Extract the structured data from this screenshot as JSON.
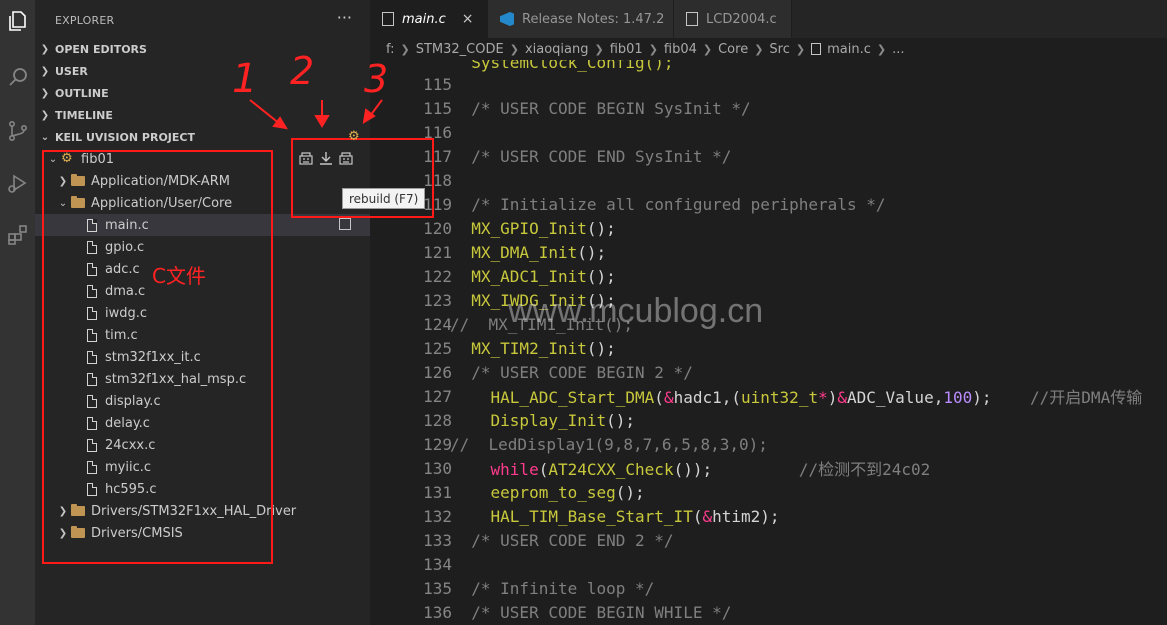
{
  "activity_bar": {
    "items": [
      {
        "name": "explorer-icon"
      },
      {
        "name": "search-icon"
      },
      {
        "name": "source-control-icon"
      },
      {
        "name": "run-debug-icon"
      },
      {
        "name": "extensions-icon"
      }
    ]
  },
  "sidebar": {
    "title": "EXPLORER",
    "more": "···",
    "sections": {
      "open_editors": "OPEN EDITORS",
      "user": "USER",
      "outline": "OUTLINE",
      "timeline": "TIMELINE",
      "keil": "KEIL UVISION PROJECT"
    },
    "project": "fib01",
    "folders": {
      "mdk": "Application/MDK-ARM",
      "core": "Application/User/Core",
      "hal": "Drivers/STM32F1xx_HAL_Driver",
      "cmsis": "Drivers/CMSIS"
    },
    "files": [
      "main.c",
      "gpio.c",
      "adc.c",
      "dma.c",
      "iwdg.c",
      "tim.c",
      "stm32f1xx_it.c",
      "stm32f1xx_hal_msp.c",
      "display.c",
      "delay.c",
      "24cxx.c",
      "myiic.c",
      "hc595.c"
    ],
    "toolbar_icons": [
      "build-icon",
      "download-icon",
      "rebuild-icon"
    ]
  },
  "tabs": [
    {
      "label": "main.c",
      "active": true
    },
    {
      "label": "Release Notes: 1.47.2",
      "active": false
    },
    {
      "label": "LCD2004.c",
      "active": false
    }
  ],
  "breadcrumb": [
    "f:",
    "STM32_CODE",
    "xiaoqiang",
    "fib01",
    "fib04",
    "Core",
    "Src",
    "main.c",
    "..."
  ],
  "tooltip": "rebuild (F7)",
  "editor": {
    "line_numbers": [
      "115",
      "116",
      "117",
      "118",
      "119",
      "120",
      "121",
      "122",
      "123",
      "124",
      "125",
      "126",
      "127",
      "128",
      "129",
      "130",
      "131",
      "132",
      "133",
      "134",
      "135",
      "136"
    ],
    "partial_top_line": "  SystemClock_Config();",
    "lines": {
      "l115": "  /* USER CODE BEGIN SysInit */",
      "l117": "  /* USER CODE END SysInit */",
      "l119": "  /* Initialize all configured peripherals */",
      "l120": "MX_GPIO_Init",
      "l121": "MX_DMA_Init",
      "l122": "MX_ADC1_Init",
      "l123": "MX_IWDG_Init",
      "l124": "//  MX_TIM1_Init();",
      "l125": "MX_TIM2_Init",
      "l126": "  /* USER CODE BEGIN 2 */",
      "l127_fn": "HAL_ADC_Start_DMA",
      "l127_a": "hadc1,(",
      "l127_ty": "uint32_t",
      "l127_b": "ADC_Value,",
      "l127_num": "100",
      "l127_end": ");",
      "l127_cm": "//开启DMA传输",
      "l128": "Display_Init",
      "l129": "//  LedDisplay1(9,8,7,6,5,8,3,0);",
      "l130_kw": "while",
      "l130_fn": "AT24CXX_Check",
      "l130_cm": "//检测不到24c02",
      "l131": "eeprom_to_seg",
      "l132": "HAL_TIM_Base_Start_IT",
      "l132_arg": "htim2",
      "l133": "  /* USER CODE END 2 */",
      "l135": "  /* Infinite loop */",
      "l136": "  /* USER CODE BEGIN WHILE */"
    }
  },
  "annotations": {
    "numbers": [
      "1",
      "2",
      "3"
    ],
    "c_files_label": "C文件"
  },
  "watermark": "www.mcublog.cn",
  "colors": {
    "annotation_red": "#ff1a1a",
    "comment": "#6a9955",
    "function": "#dcdcaa",
    "keyword": "#c586c0"
  }
}
